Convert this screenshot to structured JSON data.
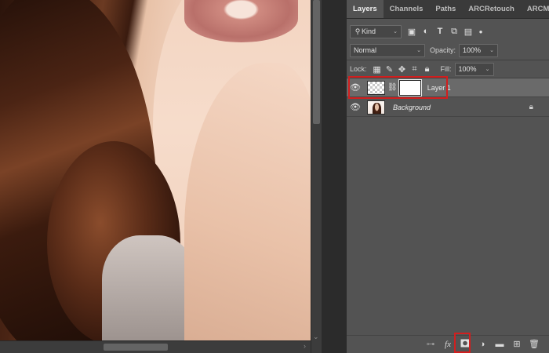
{
  "panel": {
    "tabs": [
      "Layers",
      "Channels",
      "Paths",
      "ARCRetouch",
      "ARCMask"
    ],
    "active_tab": "Layers",
    "filter": {
      "label": "Kind",
      "icon": "search-icon"
    },
    "filter_icons": [
      "image-filter-icon",
      "adjustment-filter-icon",
      "type-filter-icon",
      "shape-filter-icon",
      "smart-object-filter-icon",
      "filter-toggle-icon"
    ],
    "blend_mode": "Normal",
    "opacity_label": "Opacity:",
    "opacity_value": "100%",
    "locks_label": "Lock:",
    "lock_icons": [
      "lock-transparent-icon",
      "lock-image-icon",
      "lock-position-icon",
      "lock-artboard-icon",
      "lock-all-icon"
    ],
    "fill_label": "Fill:",
    "fill_value": "100%"
  },
  "layers": [
    {
      "name": "Layer 1",
      "visible": true,
      "selected": true,
      "has_mask": true,
      "highlighted": true
    },
    {
      "name": "Background",
      "visible": true,
      "selected": false,
      "locked": true,
      "italic": true
    }
  ],
  "bottom_bar": {
    "buttons": [
      "link-layers-icon",
      "fx-icon",
      "add-mask-icon",
      "adjustment-layer-icon",
      "new-group-icon",
      "new-layer-icon",
      "trash-icon"
    ],
    "fx_label": "fx",
    "highlighted": "add-mask-icon"
  },
  "colors": {
    "highlight": "#d11f1f",
    "panel_bg": "#535353",
    "selected_row": "#6a6a6a"
  }
}
